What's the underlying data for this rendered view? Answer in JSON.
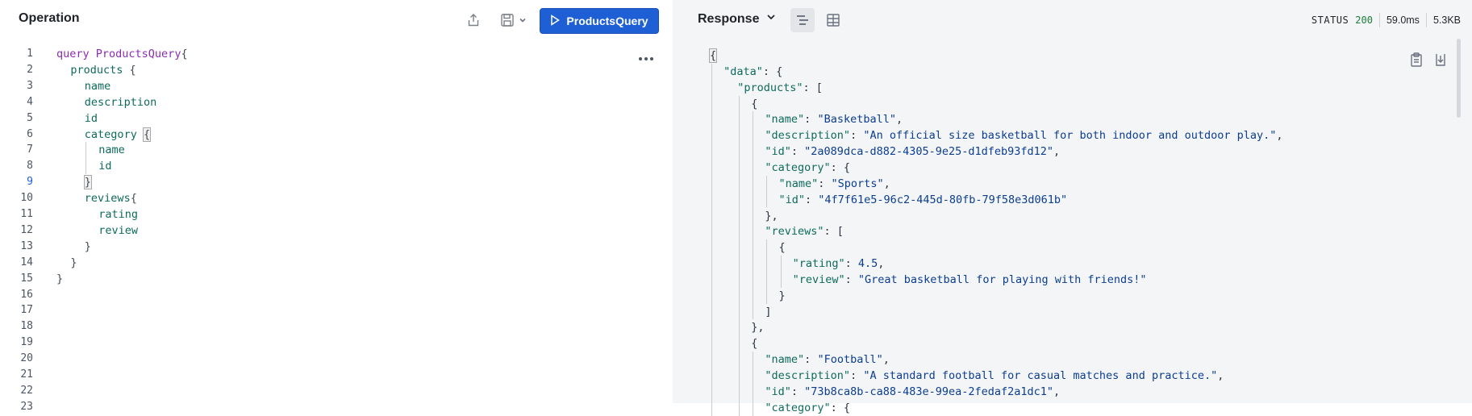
{
  "operation": {
    "title": "Operation",
    "run_label": "ProductsQuery",
    "icons": {
      "share": "share-icon",
      "save": "save-icon",
      "menu": "chevron-down-icon",
      "more": "ellipsis-icon",
      "run": "play-icon"
    },
    "active_line": 9,
    "lines": [
      {
        "n": "1",
        "indent": 0,
        "tokens": [
          {
            "t": "query ",
            "c": "kw"
          },
          {
            "t": "ProductsQuery",
            "c": "opname"
          },
          {
            "t": "{",
            "c": "punct"
          }
        ]
      },
      {
        "n": "2",
        "indent": 1,
        "tokens": [
          {
            "t": "products ",
            "c": "field"
          },
          {
            "t": "{",
            "c": "punct"
          }
        ]
      },
      {
        "n": "3",
        "indent": 2,
        "tokens": [
          {
            "t": "name",
            "c": "field"
          }
        ]
      },
      {
        "n": "4",
        "indent": 2,
        "tokens": [
          {
            "t": "description",
            "c": "field"
          }
        ]
      },
      {
        "n": "5",
        "indent": 2,
        "tokens": [
          {
            "t": "id",
            "c": "field"
          }
        ]
      },
      {
        "n": "6",
        "indent": 2,
        "tokens": [
          {
            "t": "category ",
            "c": "field"
          },
          {
            "t": "{",
            "c": "punct bracket-hl"
          }
        ]
      },
      {
        "n": "7",
        "indent": 3,
        "tokens": [
          {
            "t": "name",
            "c": "field"
          }
        ]
      },
      {
        "n": "8",
        "indent": 3,
        "tokens": [
          {
            "t": "id",
            "c": "field"
          }
        ]
      },
      {
        "n": "9",
        "indent": 2,
        "tokens": [
          {
            "t": "}",
            "c": "punct bracket-hl"
          }
        ]
      },
      {
        "n": "10",
        "indent": 2,
        "tokens": [
          {
            "t": "reviews",
            "c": "field"
          },
          {
            "t": "{",
            "c": "punct"
          }
        ]
      },
      {
        "n": "11",
        "indent": 3,
        "tokens": [
          {
            "t": "rating",
            "c": "field"
          }
        ]
      },
      {
        "n": "12",
        "indent": 3,
        "tokens": [
          {
            "t": "review",
            "c": "field"
          }
        ]
      },
      {
        "n": "13",
        "indent": 2,
        "tokens": [
          {
            "t": "}",
            "c": "punct"
          }
        ]
      },
      {
        "n": "14",
        "indent": 1,
        "tokens": [
          {
            "t": "}",
            "c": "punct"
          }
        ]
      },
      {
        "n": "15",
        "indent": 0,
        "tokens": [
          {
            "t": "}",
            "c": "punct"
          }
        ]
      },
      {
        "n": "16",
        "indent": 0,
        "tokens": []
      },
      {
        "n": "17",
        "indent": 0,
        "tokens": []
      },
      {
        "n": "18",
        "indent": 0,
        "tokens": []
      },
      {
        "n": "19",
        "indent": 0,
        "tokens": []
      },
      {
        "n": "20",
        "indent": 0,
        "tokens": []
      },
      {
        "n": "21",
        "indent": 0,
        "tokens": []
      },
      {
        "n": "22",
        "indent": 0,
        "tokens": []
      },
      {
        "n": "23",
        "indent": 0,
        "tokens": []
      }
    ]
  },
  "response": {
    "title": "Response",
    "status_label": "STATUS",
    "status_code": "200",
    "time": "59.0ms",
    "size": "5.3KB",
    "icons": {
      "dropdown": "chevron-down-icon",
      "json_view": "text-lines-icon",
      "table_view": "table-grid-icon",
      "copy": "clipboard-icon",
      "download": "download-icon"
    },
    "lines": [
      {
        "indent": 0,
        "tokens": [
          {
            "t": "{",
            "c": "jp bracket-hl"
          }
        ]
      },
      {
        "indent": 1,
        "tokens": [
          {
            "t": "\"data\"",
            "c": "jkey"
          },
          {
            "t": ": {",
            "c": "jp"
          }
        ]
      },
      {
        "indent": 2,
        "tokens": [
          {
            "t": "\"products\"",
            "c": "jkey"
          },
          {
            "t": ": [",
            "c": "jp"
          }
        ]
      },
      {
        "indent": 3,
        "tokens": [
          {
            "t": "{",
            "c": "jp"
          }
        ]
      },
      {
        "indent": 4,
        "tokens": [
          {
            "t": "\"name\"",
            "c": "jkey"
          },
          {
            "t": ": ",
            "c": "jp"
          },
          {
            "t": "\"Basketball\"",
            "c": "jstr"
          },
          {
            "t": ",",
            "c": "jp"
          }
        ]
      },
      {
        "indent": 4,
        "tokens": [
          {
            "t": "\"description\"",
            "c": "jkey"
          },
          {
            "t": ": ",
            "c": "jp"
          },
          {
            "t": "\"An official size basketball for both indoor and outdoor play.\"",
            "c": "jstr"
          },
          {
            "t": ",",
            "c": "jp"
          }
        ]
      },
      {
        "indent": 4,
        "tokens": [
          {
            "t": "\"id\"",
            "c": "jkey"
          },
          {
            "t": ": ",
            "c": "jp"
          },
          {
            "t": "\"2a089dca-d882-4305-9e25-d1dfeb93fd12\"",
            "c": "jstr"
          },
          {
            "t": ",",
            "c": "jp"
          }
        ]
      },
      {
        "indent": 4,
        "tokens": [
          {
            "t": "\"category\"",
            "c": "jkey"
          },
          {
            "t": ": {",
            "c": "jp"
          }
        ]
      },
      {
        "indent": 5,
        "tokens": [
          {
            "t": "\"name\"",
            "c": "jkey"
          },
          {
            "t": ": ",
            "c": "jp"
          },
          {
            "t": "\"Sports\"",
            "c": "jstr"
          },
          {
            "t": ",",
            "c": "jp"
          }
        ]
      },
      {
        "indent": 5,
        "tokens": [
          {
            "t": "\"id\"",
            "c": "jkey"
          },
          {
            "t": ": ",
            "c": "jp"
          },
          {
            "t": "\"4f7f61e5-96c2-445d-80fb-79f58e3d061b\"",
            "c": "jstr"
          }
        ]
      },
      {
        "indent": 4,
        "tokens": [
          {
            "t": "},",
            "c": "jp"
          }
        ]
      },
      {
        "indent": 4,
        "tokens": [
          {
            "t": "\"reviews\"",
            "c": "jkey"
          },
          {
            "t": ": [",
            "c": "jp"
          }
        ]
      },
      {
        "indent": 5,
        "tokens": [
          {
            "t": "{",
            "c": "jp"
          }
        ]
      },
      {
        "indent": 6,
        "tokens": [
          {
            "t": "\"rating\"",
            "c": "jkey"
          },
          {
            "t": ": ",
            "c": "jp"
          },
          {
            "t": "4.5",
            "c": "jnum"
          },
          {
            "t": ",",
            "c": "jp"
          }
        ]
      },
      {
        "indent": 6,
        "tokens": [
          {
            "t": "\"review\"",
            "c": "jkey"
          },
          {
            "t": ": ",
            "c": "jp"
          },
          {
            "t": "\"Great basketball for playing with friends!\"",
            "c": "jstr"
          }
        ]
      },
      {
        "indent": 5,
        "tokens": [
          {
            "t": "}",
            "c": "jp"
          }
        ]
      },
      {
        "indent": 4,
        "tokens": [
          {
            "t": "]",
            "c": "jp"
          }
        ]
      },
      {
        "indent": 3,
        "tokens": [
          {
            "t": "},",
            "c": "jp"
          }
        ]
      },
      {
        "indent": 3,
        "tokens": [
          {
            "t": "{",
            "c": "jp"
          }
        ]
      },
      {
        "indent": 4,
        "tokens": [
          {
            "t": "\"name\"",
            "c": "jkey"
          },
          {
            "t": ": ",
            "c": "jp"
          },
          {
            "t": "\"Football\"",
            "c": "jstr"
          },
          {
            "t": ",",
            "c": "jp"
          }
        ]
      },
      {
        "indent": 4,
        "tokens": [
          {
            "t": "\"description\"",
            "c": "jkey"
          },
          {
            "t": ": ",
            "c": "jp"
          },
          {
            "t": "\"A standard football for casual matches and practice.\"",
            "c": "jstr"
          },
          {
            "t": ",",
            "c": "jp"
          }
        ]
      },
      {
        "indent": 4,
        "tokens": [
          {
            "t": "\"id\"",
            "c": "jkey"
          },
          {
            "t": ": ",
            "c": "jp"
          },
          {
            "t": "\"73b8ca8b-ca88-483e-99ea-2fedaf2a1dc1\"",
            "c": "jstr"
          },
          {
            "t": ",",
            "c": "jp"
          }
        ]
      },
      {
        "indent": 4,
        "tokens": [
          {
            "t": "\"category\"",
            "c": "jkey"
          },
          {
            "t": ": {",
            "c": "jp"
          }
        ]
      }
    ]
  }
}
